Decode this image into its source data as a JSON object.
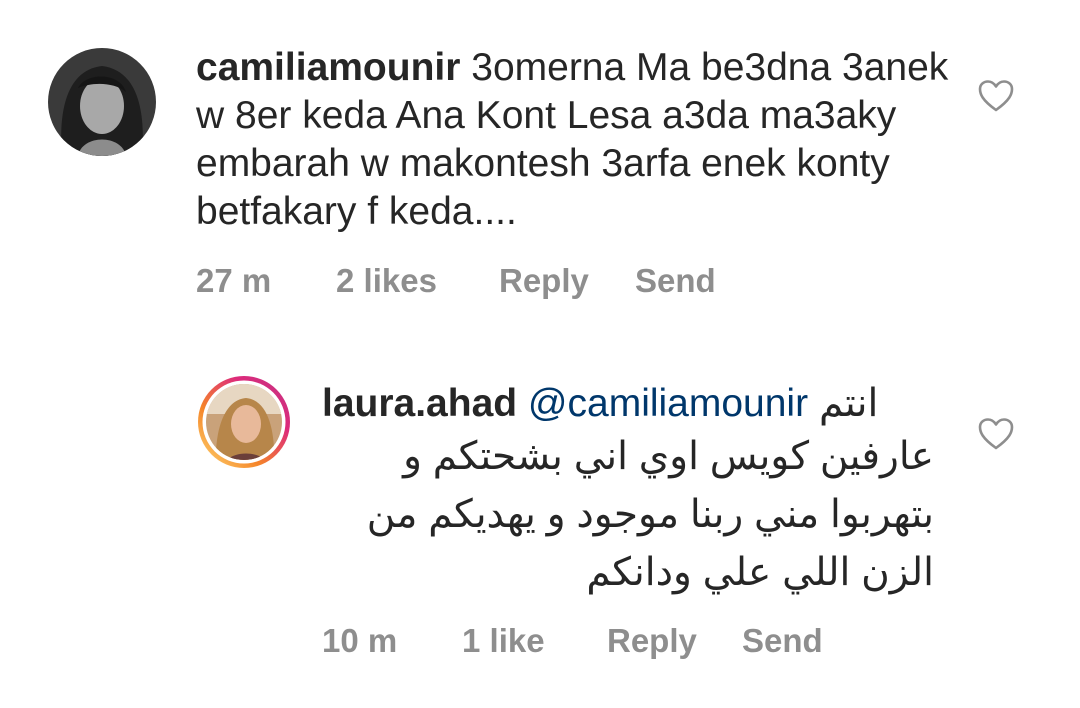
{
  "comments": [
    {
      "username": "camiliamounir",
      "text": " 3omerna Ma be3dna 3anek w 8er keda Ana Kont Lesa a3da ma3aky embarah w makontesh 3arfa enek konty betfakary f keda....",
      "time": "27 m",
      "likes": "2 likes",
      "reply_label": "Reply",
      "send_label": "Send",
      "avatar_icon": "avatar-camiliamounir",
      "like_icon": "heart-outline-icon"
    },
    {
      "username": "laura.ahad",
      "mention": "@camiliamounir",
      "text_line1": "انتم",
      "text_rest": "عارفين كويس اوي اني بشحتكم و بتهربوا مني ربنا موجود و يهديكم من الزن اللي علي ودانكم",
      "time": "10 m",
      "likes": "1 like",
      "reply_label": "Reply",
      "send_label": "Send",
      "avatar_icon": "avatar-laura-ahad-story-ring",
      "like_icon": "heart-outline-icon"
    }
  ],
  "colors": {
    "text": "#262626",
    "meta": "#8e8e8e",
    "mention": "#00376b",
    "story_ring_start": "#f58529",
    "story_ring_end": "#dd2a7b"
  }
}
